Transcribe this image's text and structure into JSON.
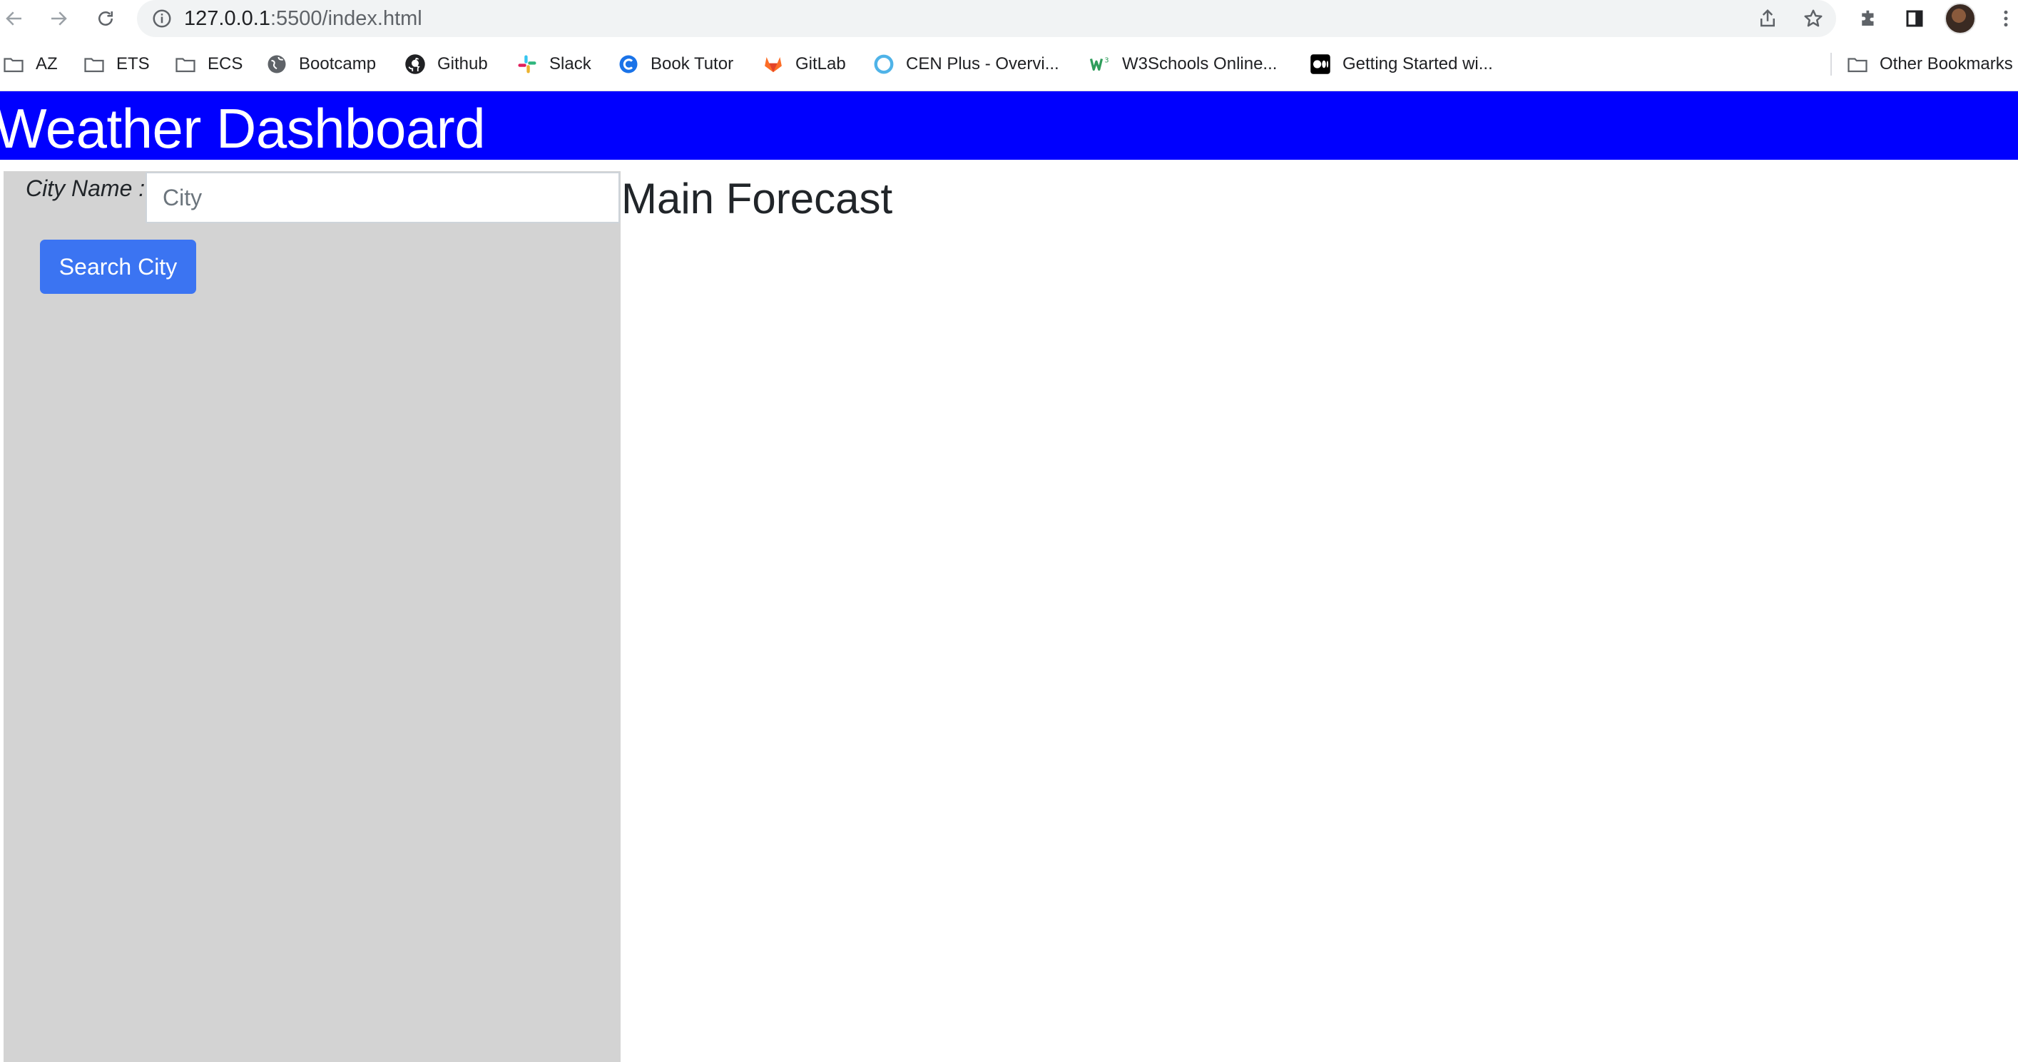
{
  "browser": {
    "url_host": "127.0.0.1",
    "url_path": ":5500/index.html",
    "bookmarks": [
      {
        "label": "AZ",
        "icon": "folder-icon"
      },
      {
        "label": "ETS",
        "icon": "folder-icon"
      },
      {
        "label": "ECS",
        "icon": "folder-icon"
      },
      {
        "label": "Bootcamp",
        "icon": "globe-icon"
      },
      {
        "label": "Github",
        "icon": "github-icon"
      },
      {
        "label": "Slack",
        "icon": "slack-icon"
      },
      {
        "label": "Book Tutor",
        "icon": "book-tutor-icon"
      },
      {
        "label": "GitLab",
        "icon": "gitlab-icon"
      },
      {
        "label": "CEN Plus - Overvi...",
        "icon": "cen-plus-icon"
      },
      {
        "label": "W3Schools Online...",
        "icon": "w3schools-icon"
      },
      {
        "label": "Getting Started wi...",
        "icon": "medium-icon"
      }
    ],
    "other_bookmarks": "Other Bookmarks"
  },
  "page": {
    "title": "Weather Dashboard",
    "sidebar": {
      "city_label": "City Name :",
      "city_placeholder": "City",
      "city_value": "",
      "search_button": "Search City"
    },
    "main": {
      "title": "Main Forecast"
    }
  },
  "colors": {
    "header_bg": "#0000ff",
    "sidebar_bg": "#d3d3d3",
    "button_bg": "#3b74f2"
  }
}
